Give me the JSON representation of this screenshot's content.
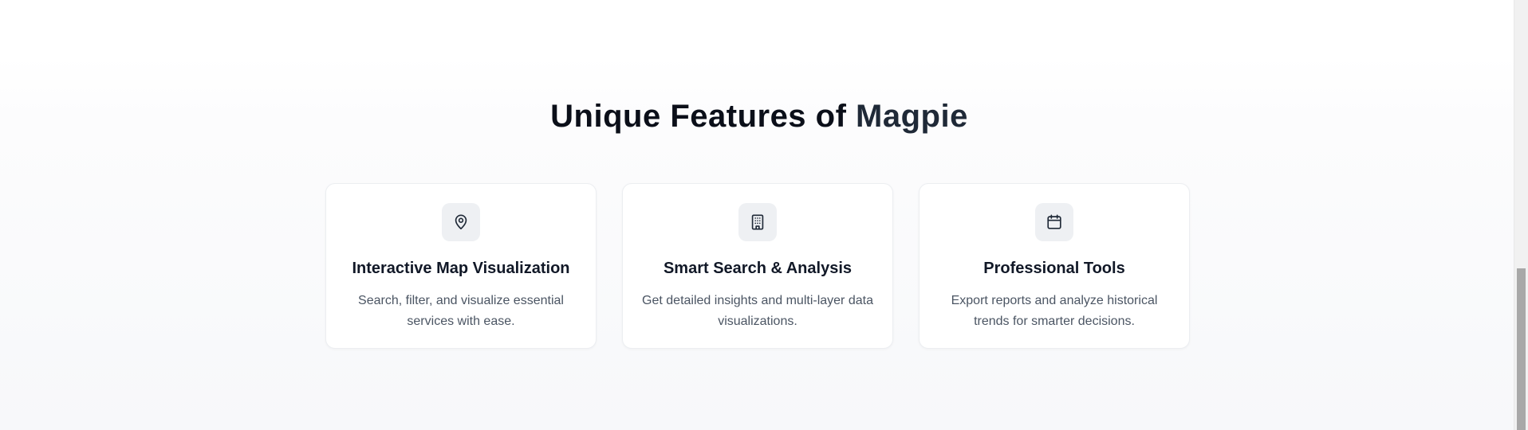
{
  "features_section": {
    "heading_prefix": "Unique Features of",
    "heading_brand": "Magpie",
    "cards": [
      {
        "icon": "map-pin-icon",
        "title": "Interactive Map Visualization",
        "description": "Search, filter, and visualize essential services with ease."
      },
      {
        "icon": "building-icon",
        "title": "Smart Search & Analysis",
        "description": "Get detailed insights and multi-layer data visualizations."
      },
      {
        "icon": "calendar-icon",
        "title": "Professional Tools",
        "description": "Export reports and analyze historical trends for smarter decisions."
      }
    ]
  },
  "colors": {
    "heading": "#0b0f19",
    "card_background": "#ffffff",
    "icon_background": "#eef0f3",
    "description_text": "#4b5563"
  }
}
